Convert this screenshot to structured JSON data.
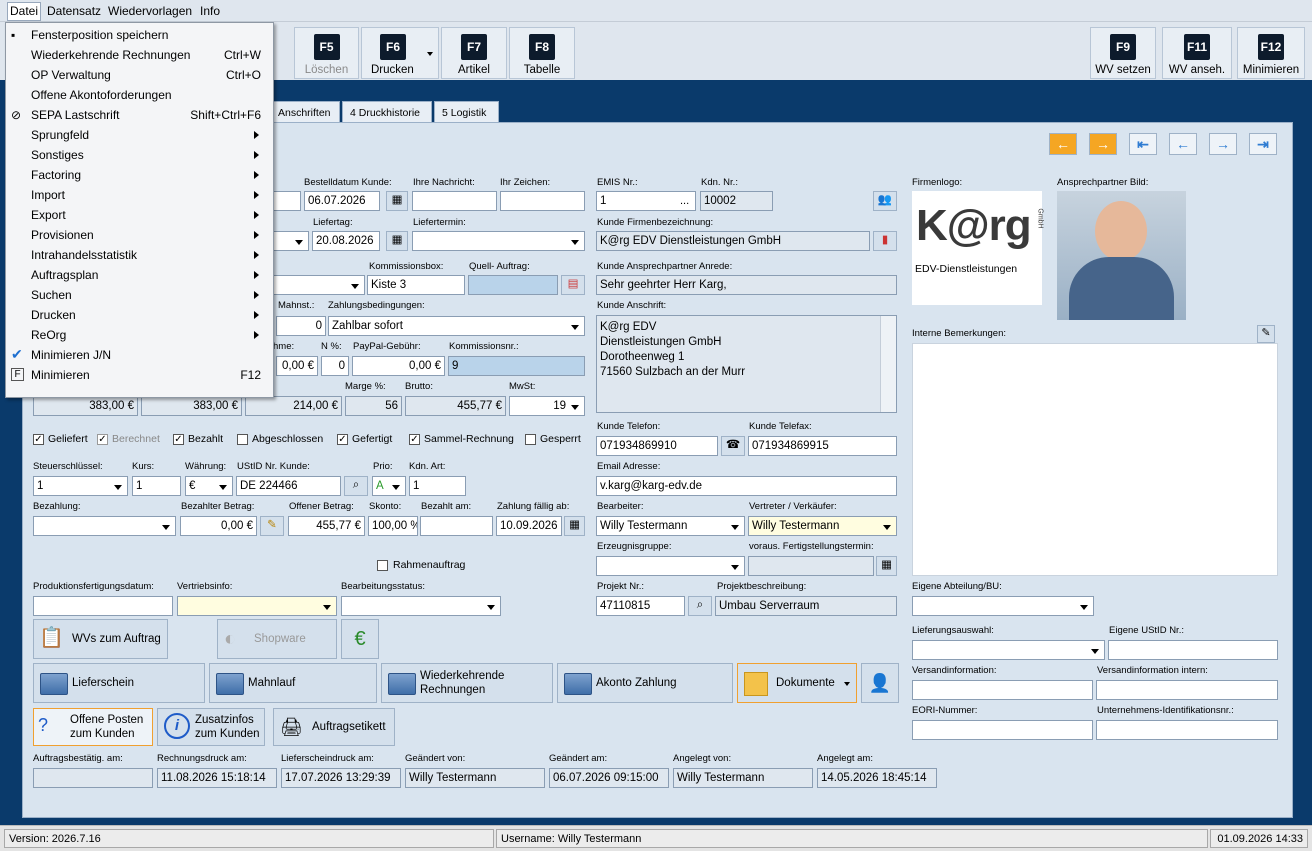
{
  "menubar": [
    "Datei",
    "Datensatz",
    "Wiedervorlagen",
    "Info"
  ],
  "toolbar": [
    {
      "key": "F5",
      "label": "Löschen"
    },
    {
      "key": "F6",
      "label": "Drucken"
    },
    {
      "key": "F7",
      "label": "Artikel"
    },
    {
      "key": "F8",
      "label": "Tabelle"
    },
    {
      "key": "F9",
      "label": "WV setzen"
    },
    {
      "key": "F11",
      "label": "WV anseh."
    },
    {
      "key": "F12",
      "label": "Minimieren"
    }
  ],
  "tabs": [
    "Anschriften",
    "4 Druckhistorie",
    "5 Logistik"
  ],
  "menu": [
    {
      "label": "Fensterposition speichern",
      "shortcut": ""
    },
    {
      "label": "Wiederkehrende Rechnungen",
      "shortcut": "Ctrl+W"
    },
    {
      "label": "OP Verwaltung",
      "shortcut": "Ctrl+O"
    },
    {
      "label": "Offene Akontoforderungen",
      "shortcut": ""
    },
    {
      "label": "SEPA Lastschrift",
      "shortcut": "Shift+Ctrl+F6"
    },
    {
      "label": "Sprungfeld",
      "shortcut": ""
    },
    {
      "label": "Sonstiges",
      "shortcut": ""
    },
    {
      "label": "Factoring",
      "shortcut": ""
    },
    {
      "label": "Import",
      "shortcut": ""
    },
    {
      "label": "Export",
      "shortcut": ""
    },
    {
      "label": "Provisionen",
      "shortcut": ""
    },
    {
      "label": "Intrahandelsstatistik",
      "shortcut": ""
    },
    {
      "label": "Auftragsplan",
      "shortcut": ""
    },
    {
      "label": "Suchen",
      "shortcut": ""
    },
    {
      "label": "Drucken",
      "shortcut": ""
    },
    {
      "label": "ReOrg",
      "shortcut": ""
    },
    {
      "label": "Minimieren J/N",
      "shortcut": ""
    },
    {
      "label": "Minimieren",
      "shortcut": "F12"
    }
  ],
  "labels": {
    "bestelldatum": "Bestelldatum Kunde:",
    "ihre_nachricht": "Ihre Nachricht:",
    "ihr_zeichen": "Ihr Zeichen:",
    "liefertag": "Liefertag:",
    "liefertermin": "Liefertermin:",
    "kommissionsbox": "Kommissionsbox:",
    "quell": "Quell- Auftrag:",
    "mahnst": "Mahnst.:",
    "zahlungsbed": "Zahlungsbedingungen:",
    "ahme": "hme:",
    "n_pct": "N %:",
    "paypal": "PayPal-Gebühr:",
    "kommnr": "Kommissionsnr.:",
    "marge": "Marge %:",
    "brutto": "Brutto:",
    "mwst": "MwSt:",
    "steuer": "Steuerschlüssel:",
    "kurs": "Kurs:",
    "waehrung": "Währung:",
    "ustid": "UStID Nr. Kunde:",
    "prio": "Prio:",
    "kdnart": "Kdn. Art:",
    "bezahlung": "Bezahlung:",
    "bez_betrag": "Bezahlter Betrag:",
    "offener": "Offener Betrag:",
    "skonto": "Skonto:",
    "bezahlt_am": "Bezahlt am:",
    "faellig": "Zahlung fällig ab:",
    "rahmen": "Rahmenauftrag",
    "prodfert": "Produktionsfertigungsdatum:",
    "vertriebsinfo": "Vertriebsinfo:",
    "bearbstatus": "Bearbeitungsstatus:",
    "emis": "EMIS Nr.:",
    "kdnnr": "Kdn. Nr.:",
    "firmenbez": "Kunde Firmenbezeichnung:",
    "anrede": "Kunde Ansprechpartner Anrede:",
    "anschrift": "Kunde Anschrift:",
    "telefon": "Kunde Telefon:",
    "telefax": "Kunde Telefax:",
    "email": "Email Adresse:",
    "bearbeiter": "Bearbeiter:",
    "vertreter": "Vertreter / Verkäufer:",
    "erzeugnis": "Erzeugnisgruppe:",
    "voraus": "voraus. Fertigstellungstermin:",
    "projekt": "Projekt Nr.:",
    "projektbeschr": "Projektbeschreibung:",
    "firmenlogo": "Firmenlogo:",
    "ansp_bild": "Ansprechpartner Bild:",
    "interne": "Interne Bemerkungen:",
    "abteilung": "Eigene Abteilung/BU:",
    "lieferungsauswahl": "Lieferungsauswahl:",
    "eigene_ust": "Eigene UStID Nr.:",
    "versandinfo": "Versandinformation:",
    "versand_intern": "Versandinformation intern:",
    "eori": "EORI-Nummer:",
    "unternehmen": "Unternehmens-Identifikationsnr.:",
    "auftragsbest": "Auftragsbestätig. am:",
    "rechnungsdruck": "Rechnungsdruck am:",
    "lieferscheindruck": "Lieferscheindruck am:",
    "geaendert_von": "Geändert von:",
    "geaendert_am": "Geändert am:",
    "angelegt_von": "Angelegt von:",
    "angelegt_am": "Angelegt am:"
  },
  "values": {
    "bestelldatum": "06.07.2026",
    "liefertag": "20.08.2026",
    "kommissionsbox": "Kiste 3",
    "mahnst": "0",
    "zahlungsbed": "Zahlbar sofort",
    "ahme": "0,00 €",
    "n_pct": "0",
    "paypal": "0,00 €",
    "kommnr": "9",
    "v1": "383,00 €",
    "v2": "383,00 €",
    "v3": "214,00 €",
    "marge": "56",
    "brutto": "455,77 €",
    "mwst": "19",
    "steuer": "1",
    "kurs": "1",
    "waehrung": "€",
    "ustid": "DE 224466",
    "prio": "A",
    "kdnart": "1",
    "bez_betrag": "0,00 €",
    "offener": "455,77 €",
    "skonto": "100,00 %",
    "faellig": "10.09.2026",
    "emis": "1",
    "kdnnr": "10002",
    "firmenbez": "K@rg EDV Dienstleistungen GmbH",
    "anrede": "Sehr geehrter Herr Karg,",
    "anschrift": [
      "K@rg EDV",
      "Dienstleistungen GmbH",
      "Dorotheenweg 1",
      "71560 Sulzbach an der Murr"
    ],
    "telefon": "071934869910",
    "telefax": "071934869915",
    "email": "v.karg@karg-edv.de",
    "bearbeiter": "Willy Testermann",
    "vertreter": "Willy Testermann",
    "projekt": "47110815",
    "projektbeschr": "Umbau Serverraum",
    "rechnungsdruck": "11.08.2026 15:18:14",
    "lieferscheindruck": "17.07.2026 13:29:39",
    "geaendert_von": "Willy Testermann",
    "geaendert_am": "06.07.2026 09:15:00",
    "angelegt_von": "Willy Testermann",
    "angelegt_am": "14.05.2026 18:45:14"
  },
  "checkboxes": [
    {
      "label": "Geliefert",
      "checked": true
    },
    {
      "label": "Berechnet",
      "checked": true
    },
    {
      "label": "Bezahlt",
      "checked": true
    },
    {
      "label": "Abgeschlossen",
      "checked": false
    },
    {
      "label": "Gefertigt",
      "checked": true
    },
    {
      "label": "Sammel-Rechnung",
      "checked": true
    },
    {
      "label": "Gesperrt",
      "checked": false
    }
  ],
  "buttons": {
    "wvs": "WVs zum Auftrag",
    "shopware": "Shopware",
    "lieferschein": "Lieferschein",
    "mahnlauf": "Mahnlauf",
    "wiederk": "Wiederkehrende Rechnungen",
    "akonto": "Akonto Zahlung",
    "dokumente": "Dokumente",
    "offene": "Offene Posten zum Kunden",
    "zusatz": "Zusatzinfos zum Kunden",
    "etikett": "Auftragsetikett"
  },
  "logo": {
    "text": "K@rg",
    "sub": "EDV-Dienstleistungen",
    "gmbh": "GmbH"
  },
  "status": {
    "version": "Version: 2026.7.16",
    "user": "Username: Willy Testermann",
    "datetime": "01.09.2026 14:33"
  }
}
